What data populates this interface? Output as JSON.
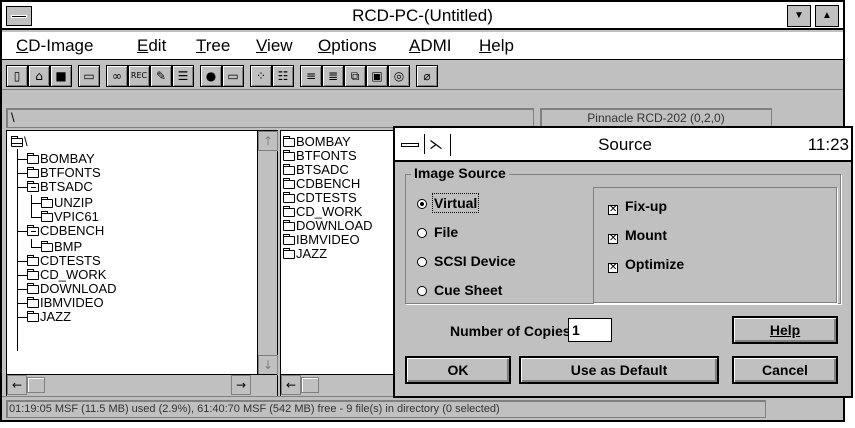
{
  "window": {
    "title": "RCD-PC-(Untitled)",
    "minimize_glyph": "▼",
    "maximize_glyph": "▲"
  },
  "menu": [
    "CD-Image",
    "Edit",
    "Tree",
    "View",
    "Options",
    "ADMI",
    "Help"
  ],
  "toolbar": {
    "icons": [
      "new-icon",
      "open-icon",
      "save-icon",
      "window-icon",
      "glasses-icon",
      "record-icon",
      "pencil-icon",
      "list-icon",
      "binoculars-icon",
      "drive-icon",
      "view-tree-icon",
      "view-list-icon",
      "sort-icon",
      "sort-alt-icon",
      "copy-icon",
      "properties-icon",
      "cd-icon",
      "eraser-icon"
    ],
    "rec_label": "REC"
  },
  "path": {
    "current": "\\",
    "device": "Pinnacle RCD-202 (0,2,0)"
  },
  "tree": {
    "root": "\\",
    "items": [
      "BOMBAY",
      "BTFONTS",
      "BTSADC",
      "UNZIP",
      "VPIC61",
      "CDBENCH",
      "BMP",
      "CDTESTS",
      "CD_WORK",
      "DOWNLOAD",
      "IBMVIDEO",
      "JAZZ"
    ]
  },
  "files": {
    "items": [
      "BOMBAY",
      "BTFONTS",
      "BTSADC",
      "CDBENCH",
      "CDTESTS",
      "CD_WORK",
      "DOWNLOAD",
      "IBMVIDEO",
      "JAZZ"
    ]
  },
  "scroll": {
    "up": "↑",
    "down": "↓",
    "left": "←",
    "right": "→"
  },
  "dialog": {
    "title": "Source",
    "time": "11:23",
    "pin_glyph": "⋋",
    "group_label": "Image Source",
    "radios": [
      {
        "label": "Virtual",
        "selected": true
      },
      {
        "label": "File",
        "selected": false
      },
      {
        "label": "SCSI Device",
        "selected": false
      },
      {
        "label": "Cue Sheet",
        "selected": false
      }
    ],
    "checkboxes": [
      {
        "label": "Fix-up",
        "checked": true
      },
      {
        "label": "Mount",
        "checked": true
      },
      {
        "label": "Optimize",
        "checked": true
      }
    ],
    "check_mark": "✕",
    "copies_label": "Number of Copies:",
    "copies_value": "1",
    "buttons": {
      "help": "Help",
      "ok": "OK",
      "default": "Use as Default",
      "cancel": "Cancel"
    }
  },
  "status": "01:19:05 MSF (11.5 MB) used (2.9%), 61:40:70 MSF (542 MB) free - 9 file(s) in directory (0 selected)"
}
